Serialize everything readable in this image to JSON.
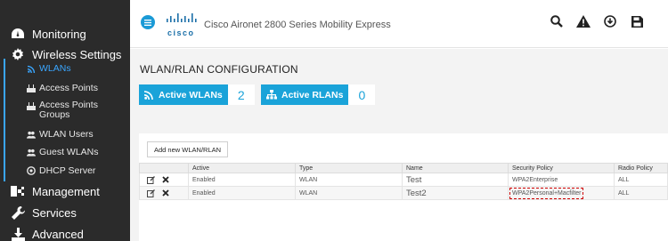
{
  "sidebar": {
    "monitoring": "Monitoring",
    "wireless_settings": "Wireless Settings",
    "wireless_items": [
      {
        "label": "WLANs",
        "icon": "wifi-icon"
      },
      {
        "label": "Access Points",
        "icon": "access-point-icon"
      },
      {
        "label": "Access Points Groups",
        "icon": "access-point-groups-icon"
      },
      {
        "label": "WLAN Users",
        "icon": "users-icon"
      },
      {
        "label": "Guest WLANs",
        "icon": "guest-users-icon"
      },
      {
        "label": "DHCP Server",
        "icon": "dhcp-icon"
      }
    ],
    "management": "Management",
    "services": "Services",
    "advanced": "Advanced"
  },
  "header": {
    "brand": "cisco",
    "title": "Cisco Aironet 2800 Series Mobility Express",
    "icons": [
      "search-icon",
      "alert-icon",
      "download-icon",
      "save-icon"
    ]
  },
  "main": {
    "title": "WLAN/RLAN CONFIGURATION",
    "active_wlans_label": "Active WLANs",
    "active_wlans_count": "2",
    "active_rlans_label": "Active RLANs",
    "active_rlans_count": "0",
    "add_button": "Add new WLAN/RLAN",
    "columns": [
      "",
      "Active",
      "Type",
      "Name",
      "Security Policy",
      "Radio Policy"
    ],
    "rows": [
      {
        "active": "Enabled",
        "type": "WLAN",
        "name": "Test",
        "security": "WPA2Enterprise",
        "radio": "ALL"
      },
      {
        "active": "Enabled",
        "type": "WLAN",
        "name": "Test2",
        "security": "WPA2Personal+Macfilter",
        "radio": "ALL"
      }
    ]
  },
  "colors": {
    "accent": "#1aa3d9",
    "sidebar_bg": "#2b2b2b",
    "highlight": "#cc0000"
  }
}
